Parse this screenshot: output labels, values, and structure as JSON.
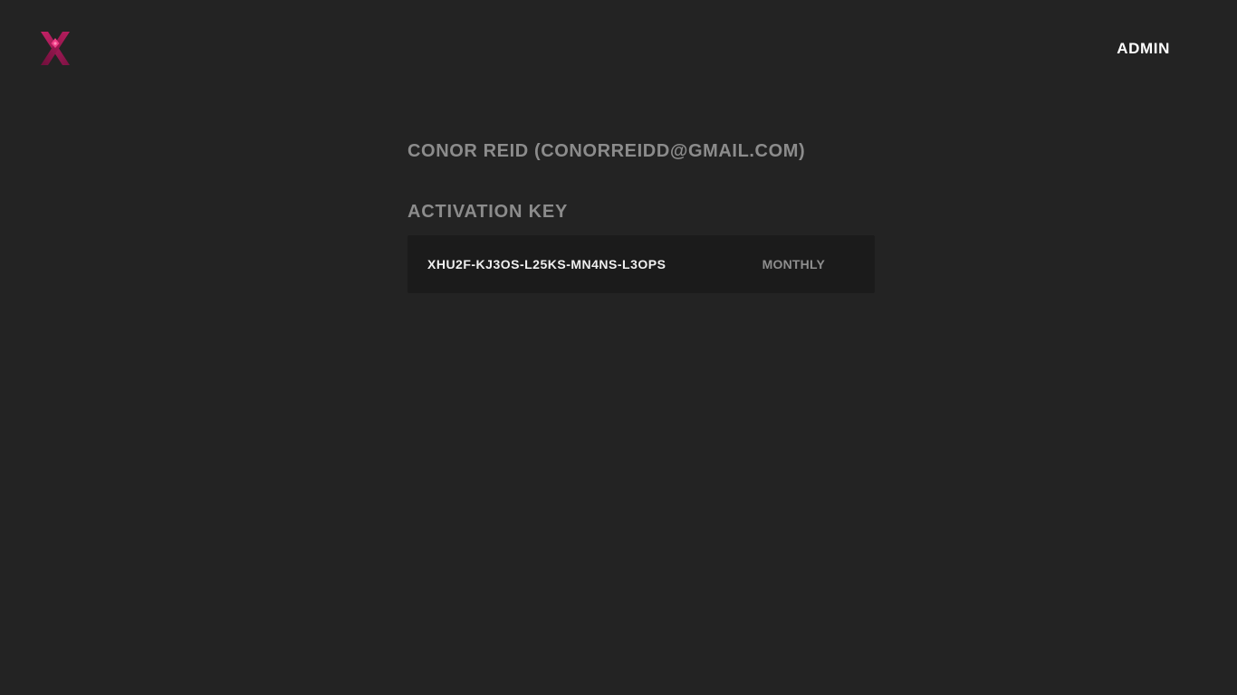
{
  "header": {
    "logo_icon": "x-logo-icon",
    "nav_admin_label": "ADMIN"
  },
  "main": {
    "user_heading": "CONOR REID (CONORREIDD@GMAIL.COM)",
    "section_title": "ACTIVATION KEY",
    "keys": [
      {
        "key": "XHU2F-KJ3OS-L25KS-MN4NS-L3OPS",
        "plan": "MONTHLY"
      }
    ]
  },
  "colors": {
    "background": "#232323",
    "card_background": "#1b1b1b",
    "logo_primary": "#a01a55",
    "logo_accent": "#e8307a",
    "muted_text": "#8c8c8c",
    "bright_text": "#ffffff"
  }
}
